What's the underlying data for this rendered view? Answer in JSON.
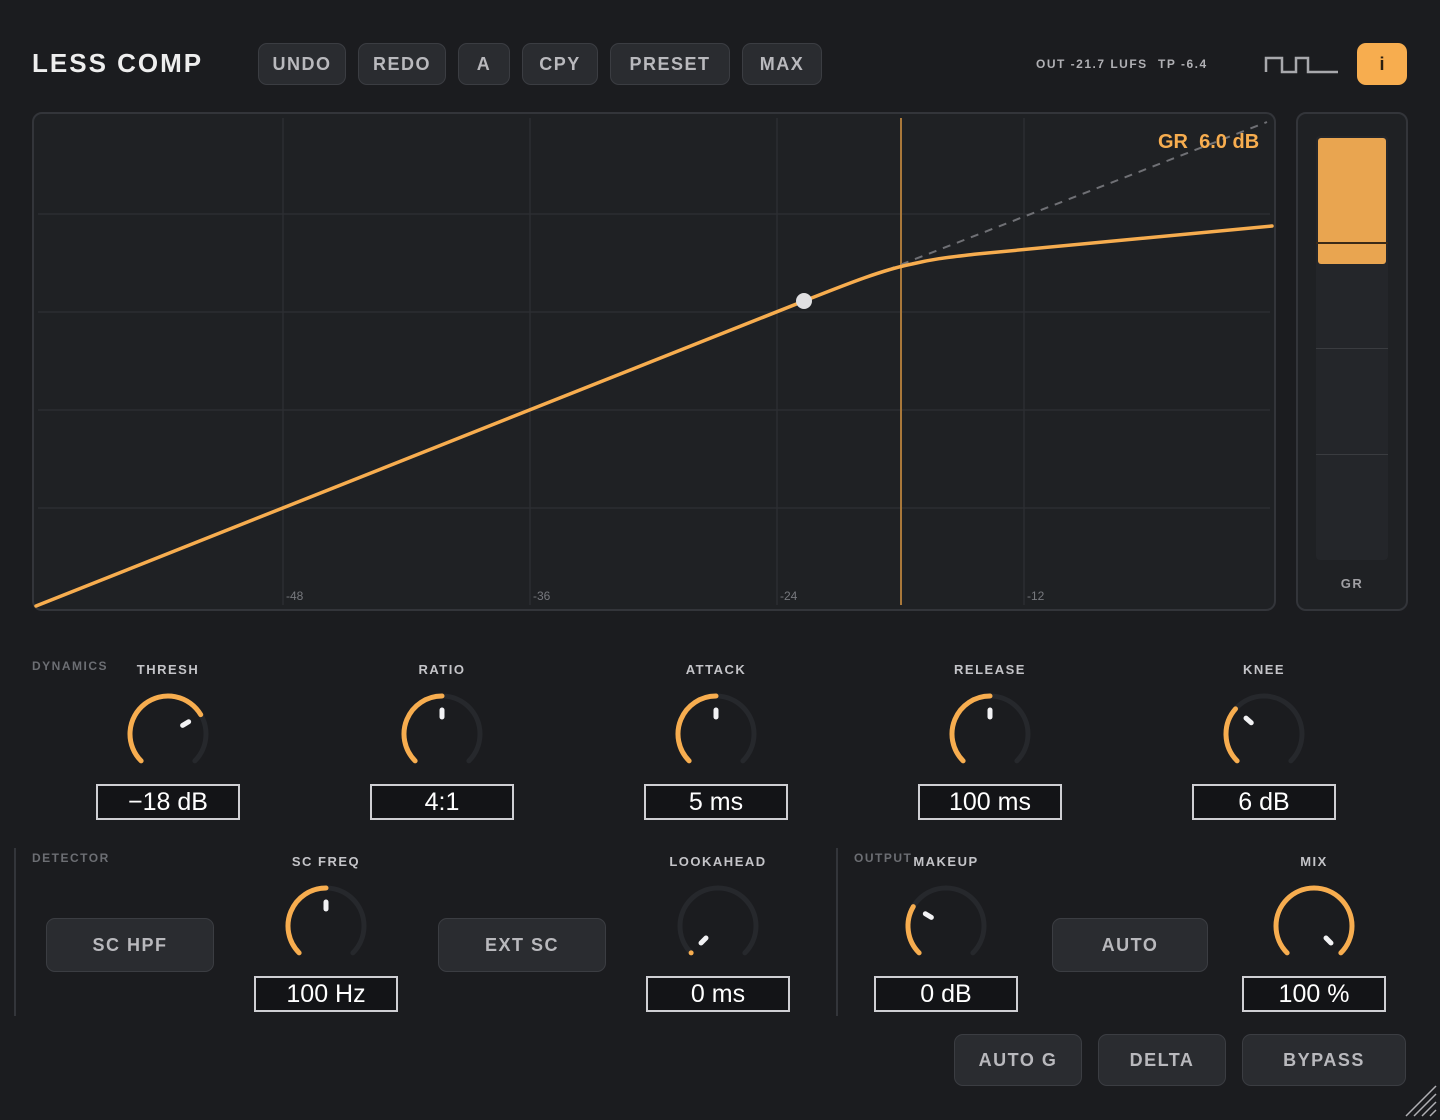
{
  "header": {
    "title": "LESS COMP",
    "buttons": [
      "UNDO",
      "REDO",
      "A",
      "CPY",
      "PRESET",
      "MAX"
    ],
    "meter": {
      "out": "OUT -21.7 LUFS",
      "tp": "TP -6.4"
    },
    "info_label": "i",
    "icons": {
      "waveform": "square-wave-icon"
    }
  },
  "graph": {
    "gr_readout": "GR  6.0 dB",
    "x_ticks": [
      "-48",
      "-36",
      "-24",
      "-12"
    ]
  },
  "gr_meter": {
    "label": "GR",
    "level_fraction": 0.3
  },
  "dynamics": {
    "section_label": "DYNAMICS",
    "knobs": [
      {
        "label": "THRESH",
        "value": "−18 dB",
        "fraction": 0.72
      },
      {
        "label": "RATIO",
        "value": "4:1",
        "fraction": 0.5
      },
      {
        "label": "ATTACK",
        "value": "5 ms",
        "fraction": 0.5
      },
      {
        "label": "RELEASE",
        "value": "100 ms",
        "fraction": 0.5
      },
      {
        "label": "KNEE",
        "value": "6 dB",
        "fraction": 0.32
      }
    ]
  },
  "detector": {
    "section_label": "DETECTOR",
    "sc_hpf_label": "SC HPF",
    "sc_freq": {
      "label": "SC FREQ",
      "value": "100 Hz",
      "fraction": 0.5
    },
    "ext_sc_label": "EXT SC",
    "lookahead": {
      "label": "LOOKAHEAD",
      "value": "0 ms",
      "fraction": 0.0
    }
  },
  "output": {
    "section_label": "OUTPUT",
    "makeup": {
      "label": "MAKEUP",
      "value": "0 dB",
      "fraction": 0.28
    },
    "auto_label": "AUTO",
    "mix": {
      "label": "MIX",
      "value": "100 %",
      "fraction": 1.0
    }
  },
  "footer": {
    "buttons": [
      "AUTO G",
      "DELTA",
      "BYPASS"
    ]
  },
  "colors": {
    "accent": "#f7ad4f",
    "knob_track": "#26282c",
    "background": "#1b1c1f",
    "panel": "#1f2124"
  }
}
